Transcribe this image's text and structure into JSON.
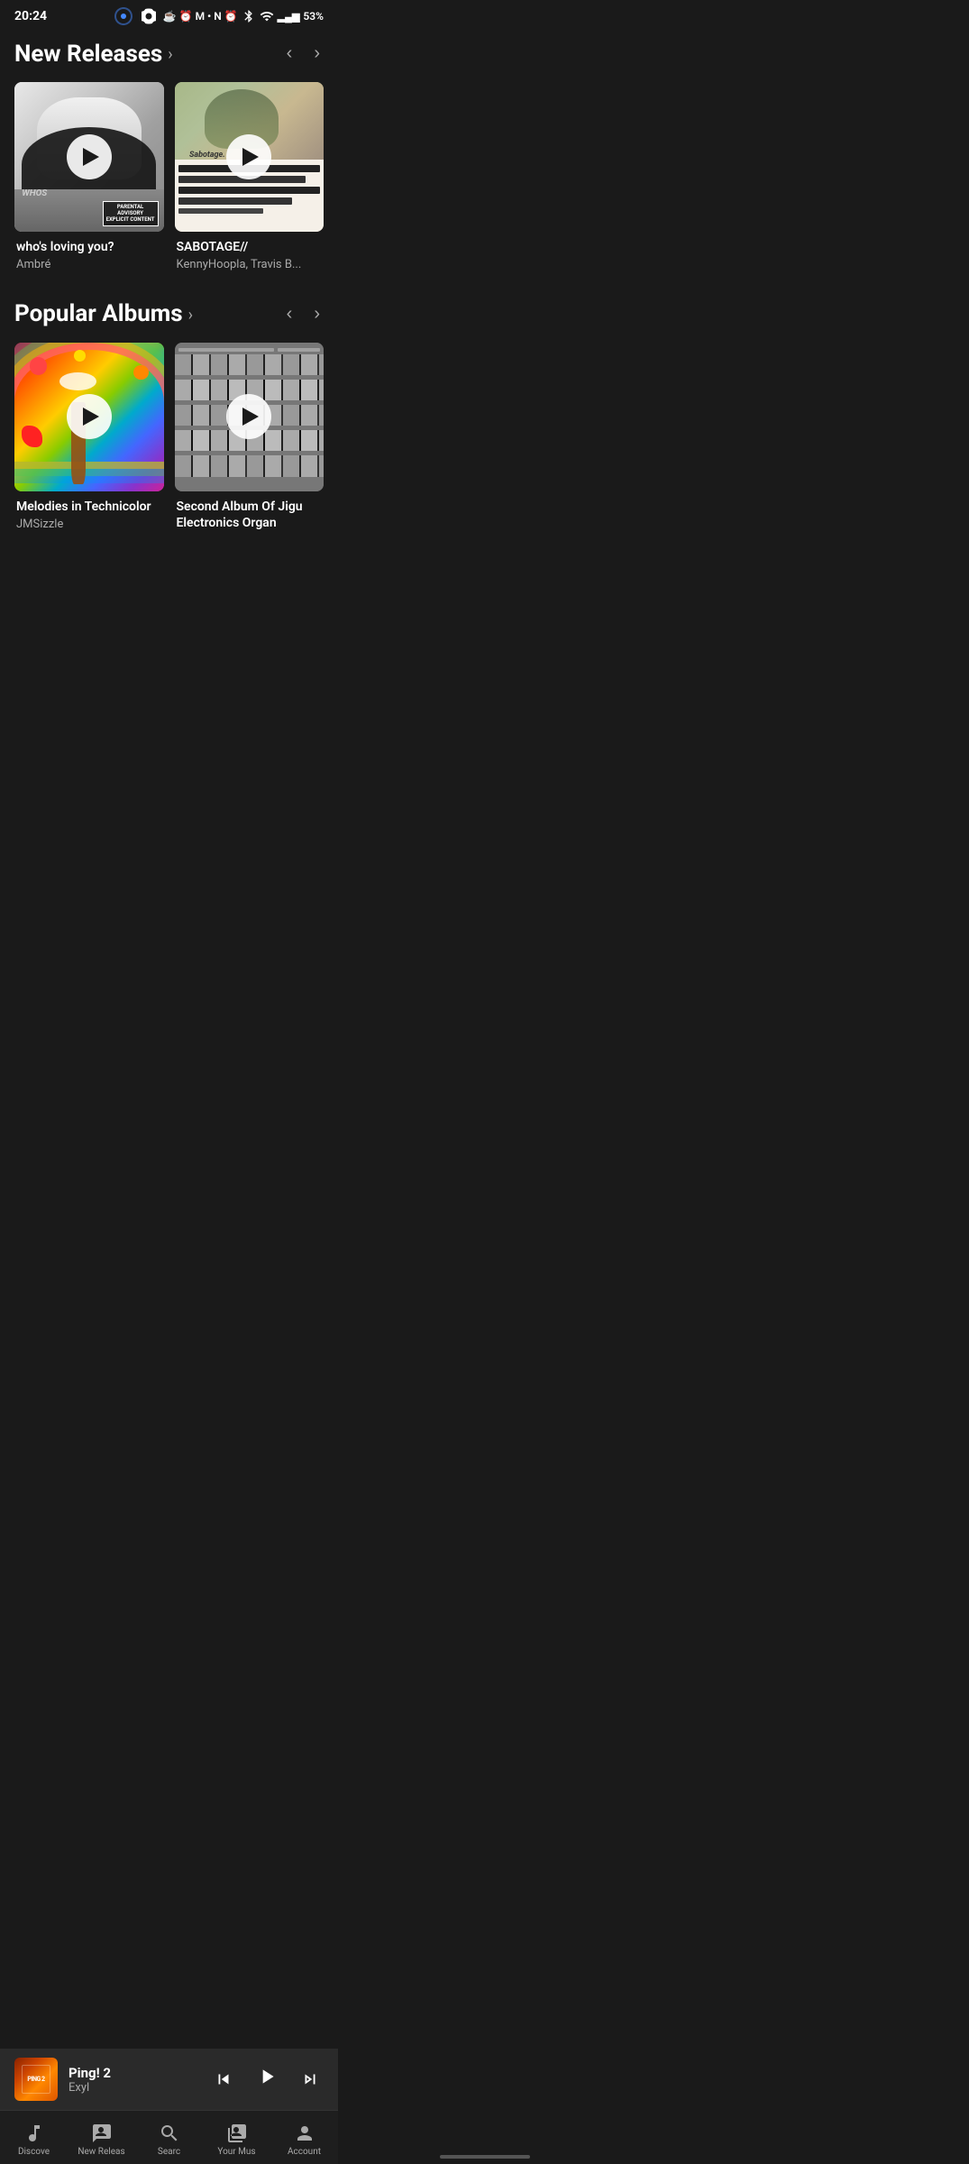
{
  "statusBar": {
    "time": "20:24",
    "battery": "53%",
    "signal": "●"
  },
  "newReleases": {
    "title": "New Releases",
    "arrow": "›",
    "prevBtn": "‹",
    "nextBtn": "›",
    "albums": [
      {
        "title": "who's loving you?",
        "artist": "Ambré",
        "hasParentalAdvisory": true,
        "artType": "bw"
      },
      {
        "title": "SABOTAGE//",
        "artist": "KennyHoopla, Travis B...",
        "hasParentalAdvisory": false,
        "artType": "sabotage"
      }
    ]
  },
  "popularAlbums": {
    "title": "Popular Albums",
    "arrow": "›",
    "prevBtn": "‹",
    "nextBtn": "›",
    "albums": [
      {
        "title": "Melodies in Technicolor",
        "artist": "JMSizzle",
        "artType": "rainbow"
      },
      {
        "title": "Second Album Of Jigu Electronics Organ",
        "artist": "",
        "artType": "piano"
      }
    ]
  },
  "nowPlaying": {
    "title": "Ping! 2",
    "artist": "Exyl",
    "artLabel": "PING 2"
  },
  "bottomNav": [
    {
      "id": "discover",
      "label": "Discove",
      "icon": "note",
      "active": false
    },
    {
      "id": "new-releases",
      "label": "New Releas",
      "icon": "badge-check",
      "active": false
    },
    {
      "id": "search",
      "label": "Searc",
      "icon": "search",
      "active": false
    },
    {
      "id": "your-music",
      "label": "Your Mus",
      "icon": "music-library",
      "active": false
    },
    {
      "id": "account",
      "label": "Account",
      "icon": "person",
      "active": false
    }
  ]
}
